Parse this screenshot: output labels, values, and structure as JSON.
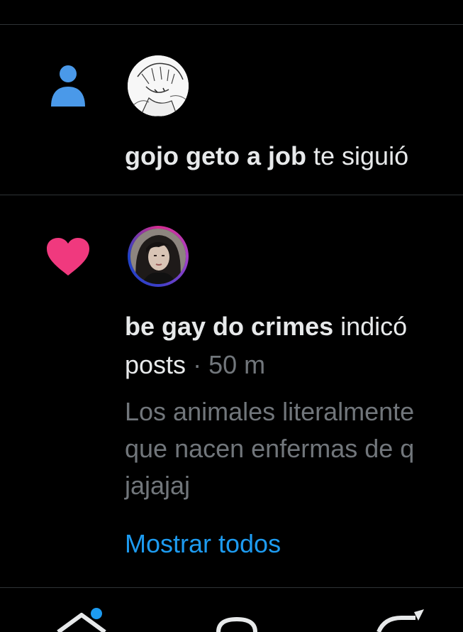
{
  "notifications": [
    {
      "type": "follow",
      "icon": "person-icon",
      "icon_color": "#4a99e9",
      "user_name": "gojo geto a job",
      "action_text": "te siguió"
    },
    {
      "type": "like",
      "icon": "heart-icon",
      "icon_color": "#f91880",
      "user_name": "be gay do crimes",
      "action_text": "indicó",
      "action_continuation": "posts",
      "separator": "·",
      "timestamp": "50 m",
      "preview_lines": [
        "Los animales literalmente",
        "que nacen enfermas de q",
        "jajajaj"
      ],
      "show_all_label": "Mostrar todos"
    }
  ],
  "bottom_nav": {
    "items": [
      "home-icon",
      "search-icon",
      "grok-icon"
    ],
    "unread_dot_color": "#1d9bf0"
  },
  "colors": {
    "background": "#000000",
    "divider": "#2f3336",
    "text_primary": "#e7e9ea",
    "text_secondary": "#71767b",
    "accent": "#1d9bf0"
  }
}
